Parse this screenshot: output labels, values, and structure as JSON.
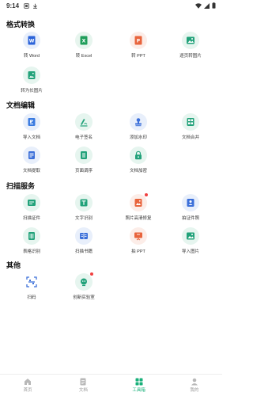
{
  "status_bar": {
    "time": "9:14"
  },
  "sections": {
    "format": {
      "title": "格式转换",
      "tools": [
        {
          "label": "转 Word",
          "icon": "word-icon",
          "color": "#2b63d9",
          "bg": "#e8effb"
        },
        {
          "label": "转 Excel",
          "icon": "excel-icon",
          "color": "#1f9e5a",
          "bg": "#e7f5ee"
        },
        {
          "label": "转 PPT",
          "icon": "ppt-icon",
          "color": "#e8643c",
          "bg": "#fcede8"
        },
        {
          "label": "逐页转图片",
          "icon": "image-icon",
          "color": "#22a27a",
          "bg": "#e6f5ef"
        },
        {
          "label": "转为长图片",
          "icon": "long-image-icon",
          "color": "#22a27a",
          "bg": "#e6f5ef"
        }
      ]
    },
    "edit": {
      "title": "文档编辑",
      "tools": [
        {
          "label": "导入文档",
          "icon": "import-doc-icon",
          "color": "#3b7be0",
          "bg": "#e8effb"
        },
        {
          "label": "电子签名",
          "icon": "signature-icon",
          "color": "#22a27a",
          "bg": "#e6f5ef"
        },
        {
          "label": "添加水印",
          "icon": "stamp-icon",
          "color": "#3b6fd9",
          "bg": "#e8effb"
        },
        {
          "label": "文档合并",
          "icon": "merge-icon",
          "color": "#22a27a",
          "bg": "#e6f5ef"
        },
        {
          "label": "文档提取",
          "icon": "extract-icon",
          "color": "#3b6fd9",
          "bg": "#e8effb"
        },
        {
          "label": "页面调序",
          "icon": "reorder-icon",
          "color": "#22a27a",
          "bg": "#e6f5ef"
        },
        {
          "label": "文档加密",
          "icon": "lock-icon",
          "color": "#22a27a",
          "bg": "#e6f5ef"
        }
      ]
    },
    "scan": {
      "title": "扫描服务",
      "tools": [
        {
          "label": "扫描证件",
          "icon": "id-scan-icon",
          "color": "#22a27a",
          "bg": "#e6f5ef"
        },
        {
          "label": "文字识别",
          "icon": "text-ocr-icon",
          "color": "#22a27a",
          "bg": "#e6f5ef"
        },
        {
          "label": "照片高清修复",
          "icon": "photo-restore-icon",
          "color": "#e8643c",
          "bg": "#fcede8"
        },
        {
          "label": "拍证件照",
          "icon": "id-photo-icon",
          "color": "#3b6fd9",
          "bg": "#e8effb"
        },
        {
          "label": "表格识别",
          "icon": "table-ocr-icon",
          "color": "#22a27a",
          "bg": "#e6f5ef"
        },
        {
          "label": "扫描书籍",
          "icon": "book-scan-icon",
          "color": "#3b6fd9",
          "bg": "#e8effb"
        },
        {
          "label": "拍 PPT",
          "icon": "photo-ppt-icon",
          "color": "#e8643c",
          "bg": "#fcede8"
        },
        {
          "label": "导入图片",
          "icon": "import-image-icon",
          "color": "#22a27a",
          "bg": "#e6f5ef"
        }
      ]
    },
    "other": {
      "title": "其他",
      "tools": [
        {
          "label": "扫码",
          "icon": "qr-scan-icon",
          "color": "#3b6fd9",
          "bg": "#ffffff"
        },
        {
          "label": "创新实验室",
          "icon": "lab-icon",
          "color": "#22a27a",
          "bg": "#e6f5ef"
        }
      ]
    }
  },
  "bottom_nav": [
    {
      "label": "首页",
      "icon": "home-icon"
    },
    {
      "label": "文档",
      "icon": "document-icon"
    },
    {
      "label": "工具箱",
      "icon": "toolbox-icon"
    },
    {
      "label": "我的",
      "icon": "profile-icon"
    }
  ],
  "colors": {
    "accent": "#19b07a",
    "badge": "#f04040",
    "inactive": "#b8b8b8"
  }
}
